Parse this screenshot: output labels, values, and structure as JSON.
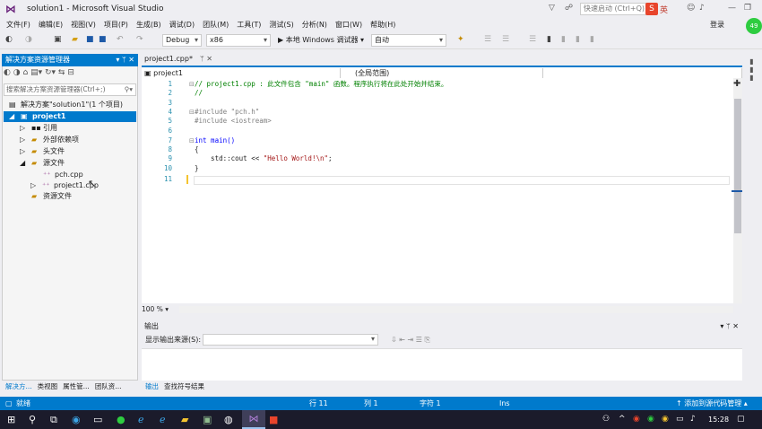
{
  "window": {
    "title": "solution1 - Microsoft Visual Studio",
    "quick_launch_placeholder": "快速启动 (Ctrl+Q)",
    "login": "登录",
    "ime": "英"
  },
  "menu": [
    "文件(F)",
    "编辑(E)",
    "视图(V)",
    "项目(P)",
    "生成(B)",
    "调试(D)",
    "团队(M)",
    "工具(T)",
    "测试(S)",
    "分析(N)",
    "窗口(W)",
    "帮助(H)"
  ],
  "toolbar": {
    "config": "Debug",
    "platform": "x86",
    "run_label": "▶ 本地 Windows 调试器 ▾",
    "auto": "自动"
  },
  "solution_explorer": {
    "title": "解决方案资源管理器",
    "search_placeholder": "搜索解决方案资源管理器(Ctrl+;)",
    "solution": "解决方案\"solution1\"(1 个项目)",
    "project": "project1",
    "items": {
      "references": "引用",
      "external": "外部依赖项",
      "headers": "头文件",
      "sources": "源文件",
      "pch": "pch.cpp",
      "main": "project1.cpp",
      "resources": "资源文件"
    },
    "tabs": [
      "解决方...",
      "类视图",
      "属性管...",
      "团队资..."
    ]
  },
  "editor": {
    "tab_label": "project1.cpp*",
    "nav_project": "project1",
    "nav_scope": "(全局范围)",
    "zoom": "100 %",
    "lines": [
      {
        "n": "1",
        "text": "// project1.cpp : 此文件包含 \"main\" 函数。程序执行将在此处开始并结束。"
      },
      {
        "n": "2",
        "text": "//"
      },
      {
        "n": "3",
        "text": ""
      },
      {
        "n": "4",
        "text": "#include \"pch.h\""
      },
      {
        "n": "5",
        "text": "#include <iostream>"
      },
      {
        "n": "6",
        "text": ""
      },
      {
        "n": "7",
        "text": "int main()"
      },
      {
        "n": "8",
        "text": "{"
      },
      {
        "n": "9",
        "text": "    std::cout << \"Hello World!\\n\";"
      },
      {
        "n": "10",
        "text": "}"
      },
      {
        "n": "11",
        "text": ""
      }
    ]
  },
  "output": {
    "title": "输出",
    "source_label": "显示输出来源(S):",
    "tabs": [
      "输出",
      "查找符号结果"
    ]
  },
  "status": {
    "ready": "就绪",
    "line": "行 11",
    "col": "列 1",
    "char": "字符 1",
    "ins": "Ins",
    "source_control": "↑ 添加到源代码管理 ▴"
  },
  "taskbar": {
    "time": "15:28"
  }
}
